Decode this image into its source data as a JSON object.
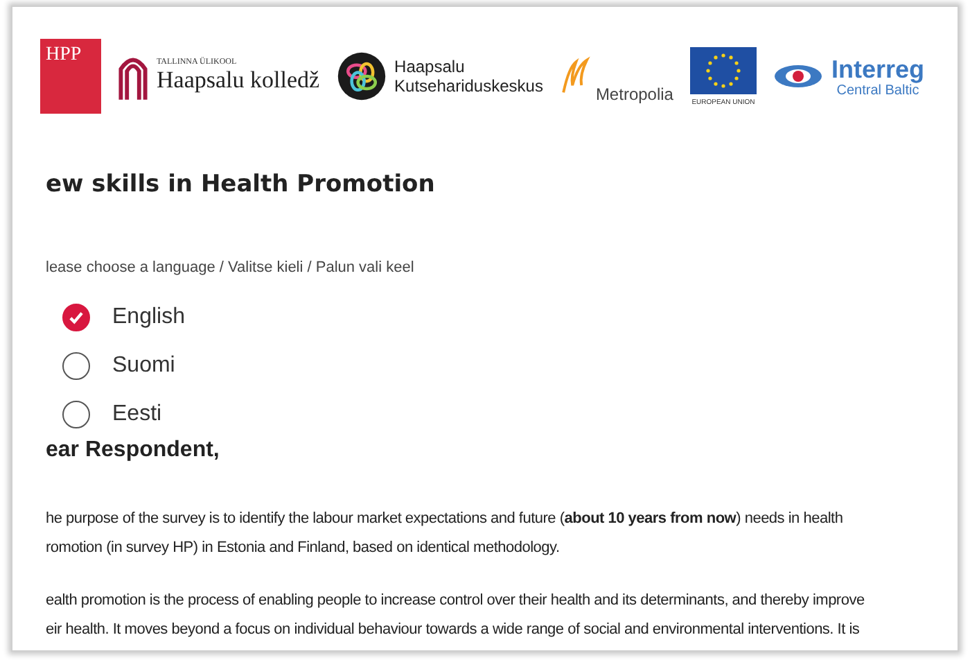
{
  "logos": {
    "hpp": {
      "text": "HPP"
    },
    "tallinn": {
      "small": "TALLINNA ÜLIKOOL",
      "name": "Haapsalu kolledž"
    },
    "kutse": {
      "line1": "Haapsalu",
      "line2": "Kutsehariduskeskus"
    },
    "metropolia": {
      "name": "Metropolia"
    },
    "eu": {
      "caption": "EUROPEAN UNION"
    },
    "interreg": {
      "name": "Interreg",
      "sub": "Central Baltic"
    }
  },
  "title": "ew skills in Health Promotion",
  "prompt": "lease choose a language / Valitse kieli / Palun vali keel",
  "options": [
    {
      "label": "English",
      "selected": true
    },
    {
      "label": "Suomi",
      "selected": false
    },
    {
      "label": "Eesti",
      "selected": false
    }
  ],
  "greeting": "ear Respondent,",
  "paragraphs": [
    {
      "lines": [
        "he purpose of the survey is to identify the labour market expectations and future (**about 10 years from now**) needs in health",
        "romotion (in survey HP) in Estonia and Finland, based on identical methodology."
      ]
    },
    {
      "lines": [
        "ealth promotion is the process of enabling people to increase control over their health and its determinants, and thereby improve",
        "eir health. It moves beyond a focus on individual behaviour towards a wide range of social and environmental interventions. It is"
      ]
    }
  ]
}
